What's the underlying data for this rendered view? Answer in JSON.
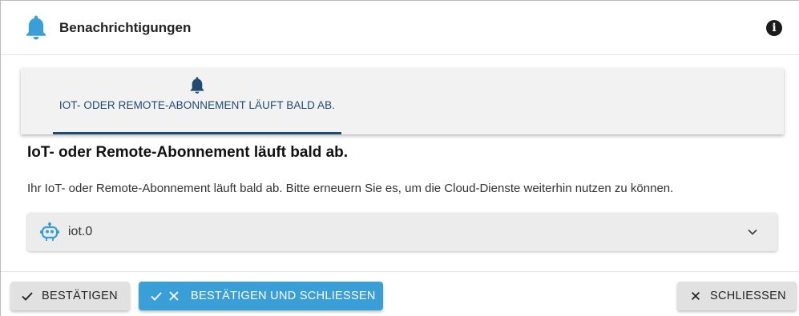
{
  "dialog": {
    "title": "Benachrichtigungen",
    "info_icon": "info-icon",
    "bell_icon": "bell-icon"
  },
  "tabs": [
    {
      "label": "IOT- ODER REMOTE-ABONNEMENT LÄUFT BALD AB.",
      "icon": "bell-icon",
      "active": true
    }
  ],
  "message": {
    "title": "IoT- oder Remote-Abonnement läuft bald ab.",
    "text": "Ihr IoT- oder Remote-Abonnement läuft bald ab. Bitte erneuern Sie es, um die Cloud-Dienste weiterhin nutzen zu können."
  },
  "instance": {
    "label": "iot.0",
    "icon": "robot-icon",
    "expand_icon": "chevron-down-icon"
  },
  "footer": {
    "confirm_label": "BESTÄTIGEN",
    "confirm_close_label": "BESTÄTIGEN UND SCHLIESSEN",
    "close_label": "SCHLIESSEN"
  },
  "colors": {
    "accent_blue": "#3a9fd6",
    "tab_blue": "#1f4a72",
    "header_bell": "#3a9fd6"
  }
}
